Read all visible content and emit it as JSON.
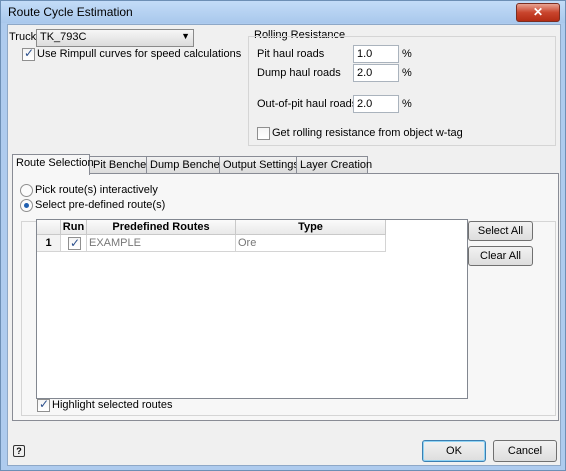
{
  "window": {
    "title": "Route Cycle Estimation",
    "close_label": "✕"
  },
  "truck": {
    "label": "Truck",
    "selected": "TK_793C",
    "rimpull_label": "Use Rimpull curves for speed calculations",
    "rimpull_checked": true
  },
  "rolling_resistance": {
    "title": "Rolling Resistance",
    "pit_label": "Pit haul roads",
    "pit_value": "1.0",
    "dump_label": "Dump haul roads",
    "dump_value": "2.0",
    "out_label": "Out-of-pit haul roads",
    "out_value": "2.0",
    "unit": "%",
    "wtag_label": "Get rolling resistance from object w-tag",
    "wtag_checked": false
  },
  "tabs": [
    {
      "label": "Route Selection",
      "active": true
    },
    {
      "label": "Pit Benches",
      "active": false
    },
    {
      "label": "Dump Benches",
      "active": false
    },
    {
      "label": "Output Settings",
      "active": false
    },
    {
      "label": "Layer Creation",
      "active": false
    }
  ],
  "route_selection": {
    "pick_label": "Pick route(s) interactively",
    "select_label": "Select pre-defined route(s)",
    "selected_option": "select",
    "columns": [
      "",
      "Run",
      "Predefined Routes",
      "Type"
    ],
    "rows": [
      {
        "index": "1",
        "run": true,
        "route": "EXAMPLE",
        "type": "Ore"
      }
    ],
    "select_all_label": "Select All",
    "clear_all_label": "Clear All",
    "highlight_label": "Highlight selected routes",
    "highlight_checked": true
  },
  "footer": {
    "help_icon": "help-icon",
    "ok_label": "OK",
    "cancel_label": "Cancel"
  }
}
